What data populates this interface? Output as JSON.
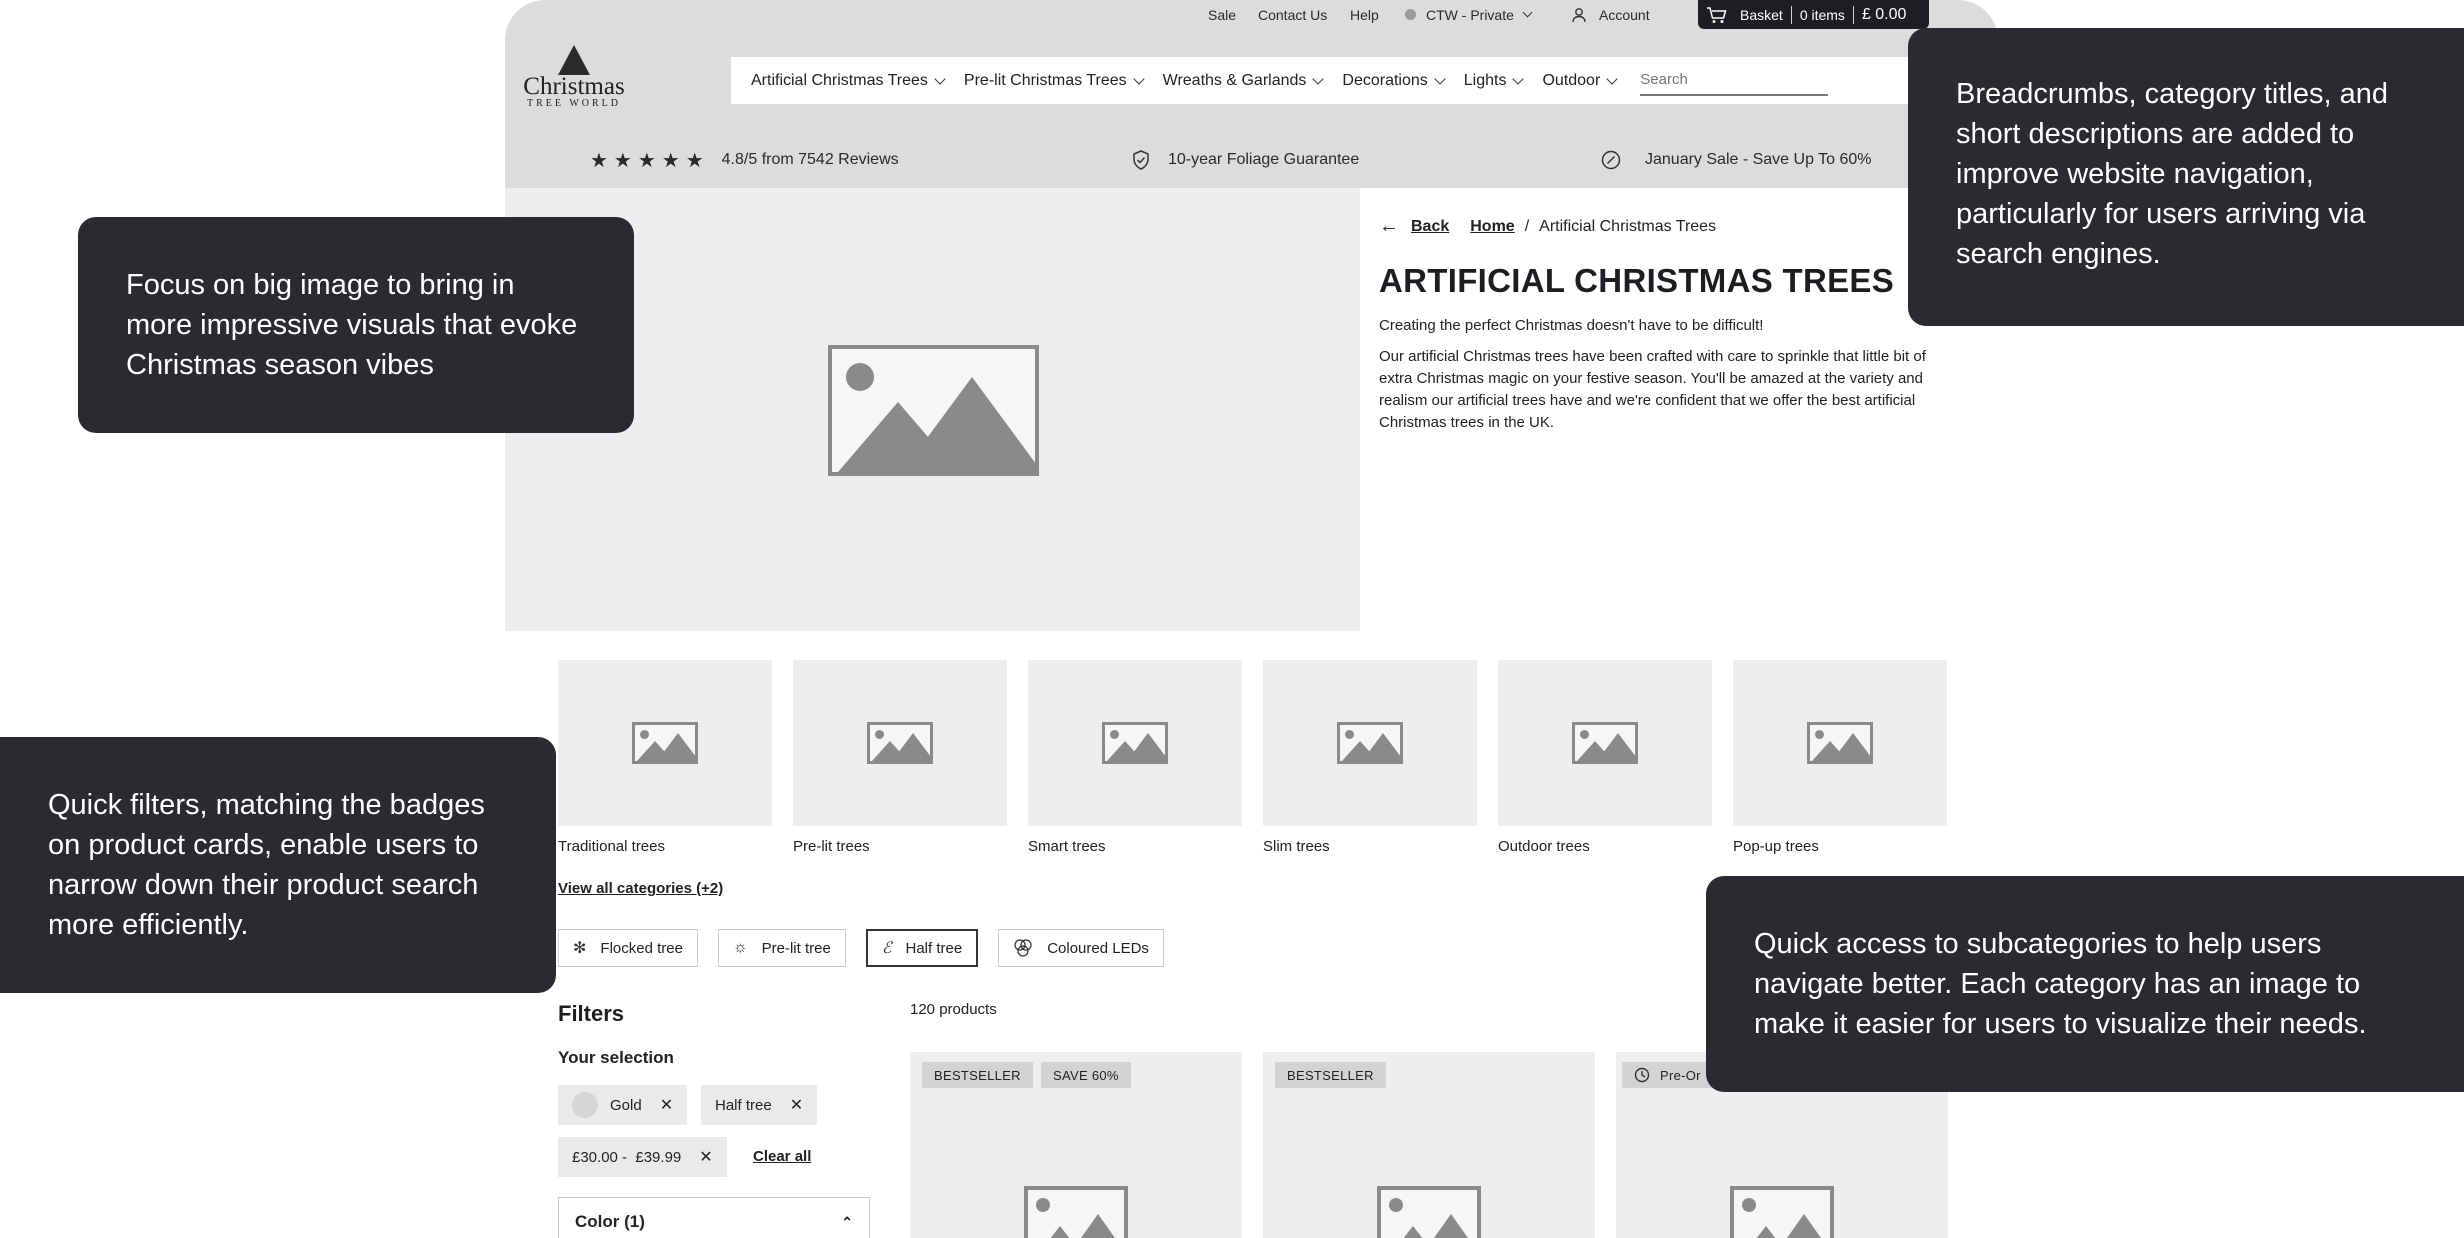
{
  "topbar": {
    "links": [
      "Sale",
      "Contact Us",
      "Help"
    ],
    "store": "CTW - Private",
    "account": "Account",
    "basket": {
      "label": "Basket",
      "items": "0 items",
      "total": "£ 0.00"
    }
  },
  "logo": {
    "word": "Christmas",
    "sub": "TREE WORLD"
  },
  "nav": {
    "items": [
      "Artificial Christmas Trees",
      "Pre-lit Christmas Trees",
      "Wreaths & Garlands",
      "Decorations",
      "Lights",
      "Outdoor"
    ],
    "search_placeholder": "Search"
  },
  "trust": {
    "rating": "4.8/5 from 7542 Reviews",
    "stars": "★★★★★",
    "guarantee": "10-year Foliage Guarantee",
    "sale": "January Sale - Save Up To 60%"
  },
  "breadcrumb": {
    "back": "Back",
    "home": "Home",
    "separator": "/",
    "current": "Artificial Christmas Trees"
  },
  "category": {
    "title": "ARTIFICIAL CHRISTMAS TREES",
    "lead": "Creating the perfect Christmas doesn't have to be difficult!",
    "description": "Our artificial Christmas trees have been crafted with care to sprinkle that little bit of extra Christmas magic on your festive season. You'll be amazed at the variety and realism our artificial trees have and we're confident that we offer the best artificial Christmas trees in the UK."
  },
  "subcategories": [
    "Traditional trees",
    "Pre-lit trees",
    "Smart trees",
    "Slim trees",
    "Outdoor trees",
    "Pop-up trees"
  ],
  "view_all": "View all categories (+2)",
  "quick_filters": [
    {
      "label": "Flocked tree",
      "icon": "snowflake-icon",
      "active": false
    },
    {
      "label": "Pre-lit tree",
      "icon": "bulb-icon",
      "active": false
    },
    {
      "label": "Half tree",
      "icon": "half-tree-icon",
      "active": true
    },
    {
      "label": "Coloured LEDs",
      "icon": "rgb-icon",
      "active": false
    }
  ],
  "filters": {
    "heading": "Filters",
    "your_selection": "Your selection",
    "selected": [
      "Gold",
      "Half tree",
      "£30.00 -  £39.99"
    ],
    "clear_all": "Clear all",
    "color_accordion": "Color (1)"
  },
  "products": {
    "count": "120 products",
    "cards": [
      {
        "badges": [
          "BESTSELLER",
          "SAVE 60%"
        ]
      },
      {
        "badges": [
          "BESTSELLER"
        ]
      },
      {
        "badges": [
          "Pre-Or"
        ]
      }
    ]
  },
  "annotations": [
    "Focus on big image to bring in more impressive visuals that evoke Christmas season vibes",
    "Breadcrumbs, category titles, and short descriptions are added to improve website navigation, particularly for users arriving via search engines.",
    "Quick filters, matching the badges on product cards, enable users to narrow down their product search more efficiently.",
    "Quick access to subcategories to help users navigate better. Each category has an image to make it easier for users to visualize their needs."
  ]
}
